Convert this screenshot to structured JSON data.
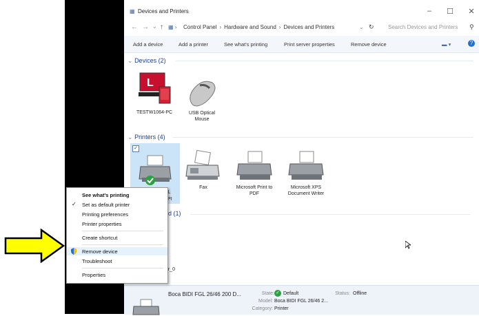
{
  "window": {
    "title": "Devices and Printers",
    "controls": {
      "minimize": "–",
      "maximize": "☐",
      "close": "✕"
    }
  },
  "address": {
    "back": "←",
    "forward": "→",
    "history": "⌄",
    "up": "↑",
    "path": [
      "Control Panel",
      "Hardware and Sound",
      "Devices and Printers"
    ],
    "search_placeholder": "Search Devices and Printers"
  },
  "commands": {
    "add_device": "Add a device",
    "add_printer": "Add a printer",
    "see_printing": "See what's printing",
    "print_server": "Print server properties",
    "remove_device": "Remove device"
  },
  "groups": {
    "devices": {
      "header": "Devices (2)",
      "items": [
        {
          "label": "TESTW1064-PC"
        },
        {
          "label1": "USB Optical",
          "label2": "Mouse"
        }
      ]
    },
    "printers": {
      "header": "Printers (4)",
      "items": [
        {
          "label1": "GL",
          "label2": "DPI"
        },
        {
          "label1": "Fax"
        },
        {
          "label1": "Microsoft Print to",
          "label2": "PDF"
        },
        {
          "label1": "Microsoft XPS",
          "label2": "Document Writer"
        }
      ]
    },
    "unspecified": {
      "header_partial": "d (1)",
      "item_partial": "er_0"
    }
  },
  "context_menu": {
    "items": [
      "See what's printing",
      "Set as default printer",
      "Printing preferences",
      "Printer properties",
      "Create shortcut",
      "Remove device",
      "Troubleshoot",
      "Properties"
    ]
  },
  "details": {
    "name": "Boca BIDI FGL 26/46 200 D...",
    "state_label": "State:",
    "state_value": "Default",
    "status_label": "Status:",
    "status_value": "Offline",
    "model_label": "Model:",
    "model_value": "Boca BIDI FGL 26/46 2...",
    "category_label": "Category:",
    "category_value": "Printer"
  },
  "colors": {
    "arrow_fill": "#ffff00",
    "accent": "#1e3f8f",
    "selection": "#cce4f7"
  }
}
